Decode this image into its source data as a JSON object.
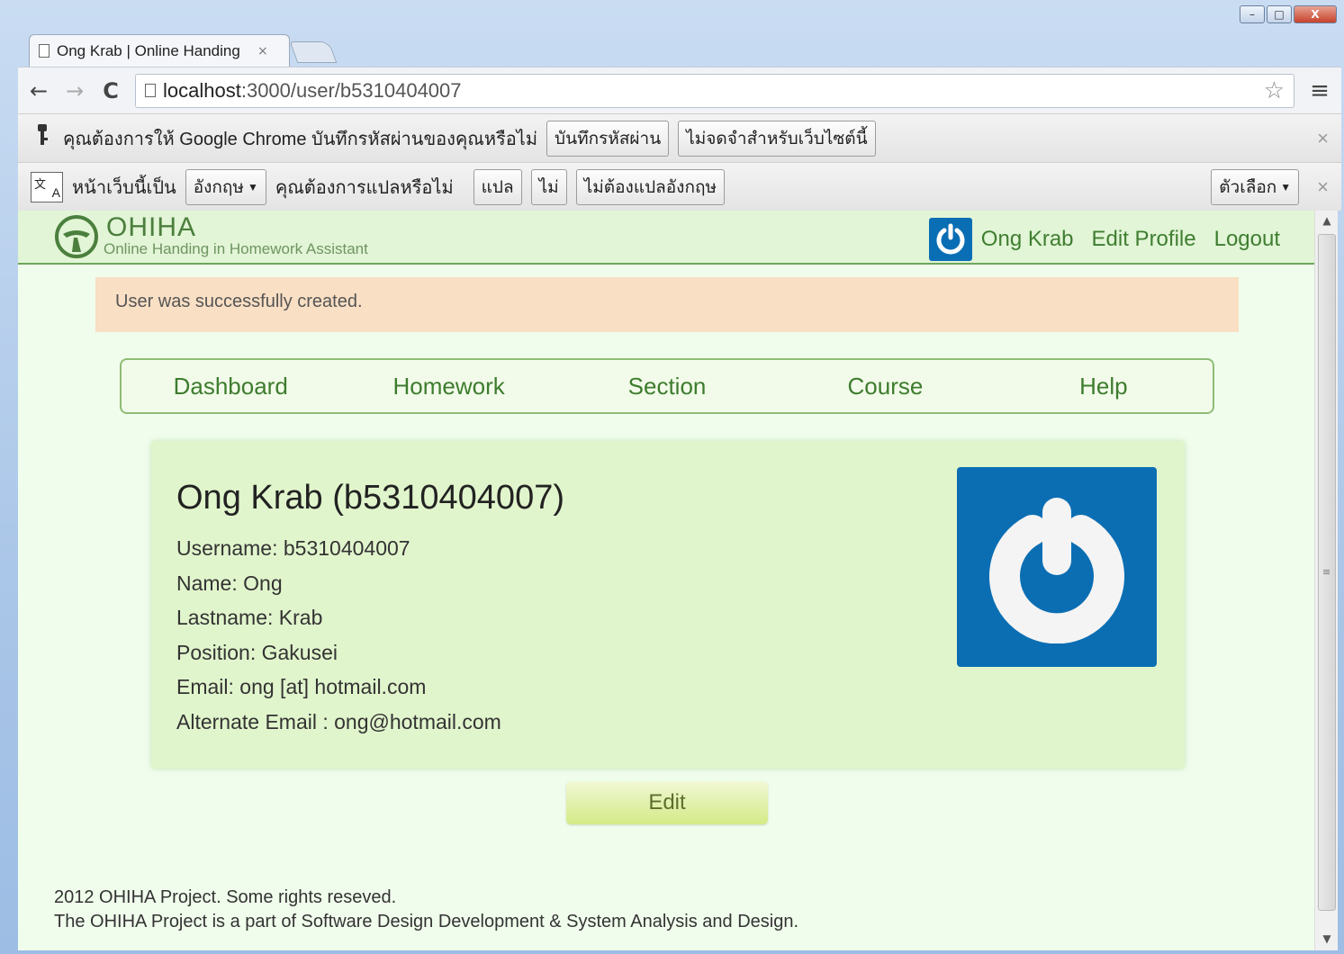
{
  "browser": {
    "tab_title": "Ong Krab | Online Handing",
    "tab_close": "×",
    "url_host": "localhost",
    "url_rest": ":3000/user/b5310404007",
    "nav_back": "←",
    "nav_forward": "→",
    "nav_reload": "C",
    "star": "☆",
    "menu": "≡",
    "window_min": "–",
    "window_max": "□",
    "window_close": "X"
  },
  "password_bar": {
    "message": "คุณต้องการให้ Google Chrome บันทึกรหัสผ่านของคุณหรือไม่",
    "save_label": "บันทึกรหัสผ่าน",
    "never_label": "ไม่จดจำสำหรับเว็บไซต์นี้",
    "close": "×"
  },
  "translate_bar": {
    "page_is_label": "หน้าเว็บนี้เป็น",
    "language": "อังกฤษ",
    "question": "คุณต้องการแปลหรือไม่",
    "translate_label": "แปล",
    "no_label": "ไม่",
    "never_label": "ไม่ต้องแปลอังกฤษ",
    "options_label": "ตัวเลือก",
    "close": "×"
  },
  "site": {
    "logo_title": "OHIHA",
    "logo_subtitle": "Online Handing in Homework Assistant",
    "user_name": "Ong Krab",
    "edit_profile": "Edit Profile",
    "logout": "Logout",
    "flash": "User was successfully created.",
    "nav": [
      "Dashboard",
      "Homework",
      "Section",
      "Course",
      "Help"
    ],
    "profile": {
      "heading": "Ong Krab (b5310404007)",
      "lines": [
        "Username: b5310404007",
        "Name: Ong",
        "Lastname: Krab",
        "Position: Gakusei",
        "Email: ong [at] hotmail.com",
        "Alternate Email : ong@hotmail.com"
      ]
    },
    "edit_button": "Edit",
    "footer_line1": "2012 OHIHA Project. Some rights reseved.",
    "footer_line2": "The OHIHA Project is a part of Software Design Development & System Analysis and Design."
  },
  "colors": {
    "accent_green": "#3f7e31",
    "avatar_blue": "#0a6eb4",
    "flash_bg": "#f9dfc4",
    "page_bg": "#f0fdec"
  }
}
